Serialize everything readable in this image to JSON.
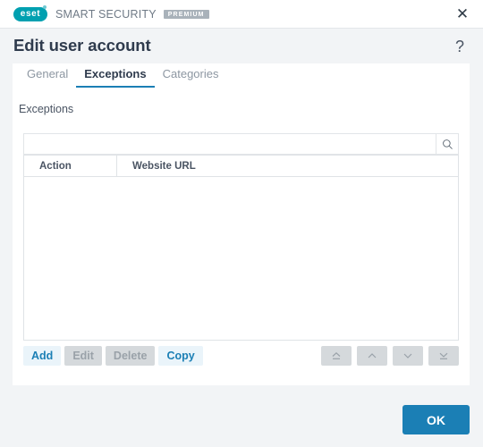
{
  "brand": {
    "logo_text": "eset",
    "product_name": "SMART SECURITY",
    "edition_badge": "PREMIUM",
    "close_label": "✕"
  },
  "dialog": {
    "title": "Edit user account",
    "help_label": "?"
  },
  "tabs": [
    {
      "label": "General",
      "active": false
    },
    {
      "label": "Exceptions",
      "active": true
    },
    {
      "label": "Categories",
      "active": false
    }
  ],
  "section": {
    "label": "Exceptions"
  },
  "search": {
    "value": "",
    "placeholder": "",
    "icon": "search-icon"
  },
  "table": {
    "columns": [
      {
        "label": "Action"
      },
      {
        "label": "Website URL"
      }
    ],
    "rows": []
  },
  "list_buttons": [
    {
      "label": "Add",
      "enabled": true
    },
    {
      "label": "Edit",
      "enabled": false
    },
    {
      "label": "Delete",
      "enabled": false
    },
    {
      "label": "Copy",
      "enabled": true
    }
  ],
  "order_buttons": [
    {
      "name": "move-to-top-icon",
      "glyph": "⤒"
    },
    {
      "name": "move-up-icon",
      "glyph": "∧"
    },
    {
      "name": "move-down-icon",
      "glyph": "∨"
    },
    {
      "name": "move-to-bottom-icon",
      "glyph": "⤓"
    }
  ],
  "footer": {
    "ok_label": "OK"
  },
  "colors": {
    "accent": "#1b7fb5",
    "brand_teal": "#00a0b0",
    "page_bg": "#f2f4f6",
    "card_bg": "#ffffff",
    "disabled_bg": "#d5d9dc",
    "enabled_btn_bg": "#eaf4fa"
  }
}
